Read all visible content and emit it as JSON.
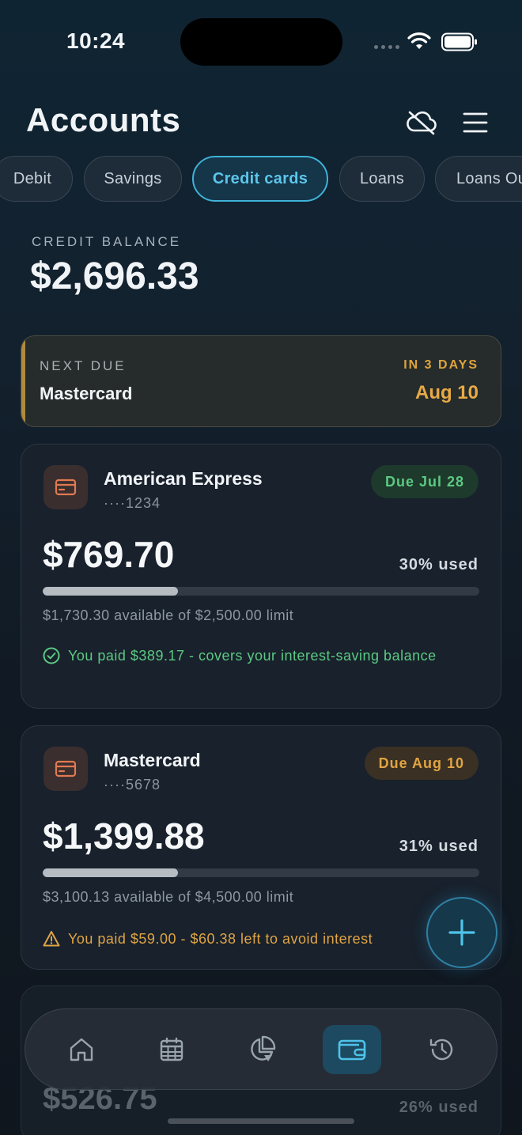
{
  "status": {
    "time": "10:24"
  },
  "header": {
    "title": "Accounts"
  },
  "tabs": [
    {
      "label": "Debit"
    },
    {
      "label": "Savings"
    },
    {
      "label": "Credit cards",
      "active": true
    },
    {
      "label": "Loans"
    },
    {
      "label": "Loans Ou"
    }
  ],
  "balance": {
    "label": "CREDIT BALANCE",
    "value": "$2,696.33"
  },
  "next_due": {
    "label": "NEXT DUE",
    "name": "Mastercard",
    "in_days": "IN 3 DAYS",
    "date": "Aug 10",
    "accent": "#b08a3e"
  },
  "cards": [
    {
      "name": "American Express",
      "number": "····1234",
      "due": "Due Jul 28",
      "amount": "$769.70",
      "used": "30% used",
      "used_fraction": 0.31,
      "available": "$1,730.30 available of $2,500.00 limit",
      "note": "You paid $389.17 - covers your interest-saving balance",
      "note_status": "ok"
    },
    {
      "name": "Mastercard",
      "number": "····5678",
      "due": "Due Aug 10",
      "amount": "$1,399.88",
      "used": "31% used",
      "used_fraction": 0.31,
      "available": "$3,100.13 available of $4,500.00 limit",
      "note": "You paid $59.00 - $60.38 left to avoid interest",
      "note_status": "warning"
    },
    {
      "amount": "$526.75",
      "used": "26% used"
    }
  ],
  "nav": [
    {
      "icon": "home-icon"
    },
    {
      "icon": "calendar-icon"
    },
    {
      "icon": "pie-chart-icon"
    },
    {
      "icon": "wallet-icon",
      "active": true
    },
    {
      "icon": "history-icon"
    }
  ],
  "colors": {
    "accent": "#3fb3d8",
    "success": "#5cc982",
    "warning": "#e0a443"
  }
}
